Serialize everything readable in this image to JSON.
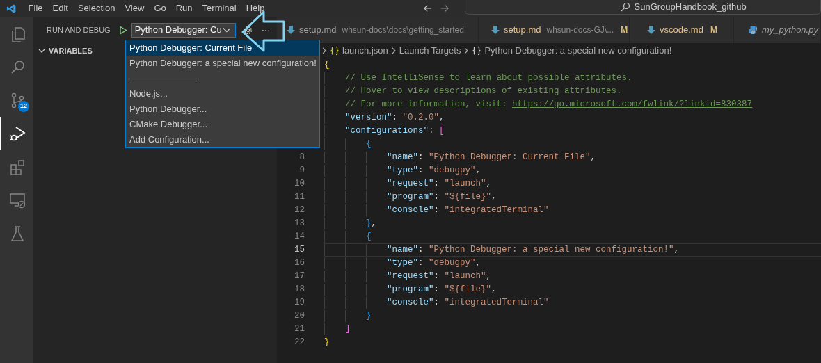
{
  "title_bar": {
    "menu": [
      "File",
      "Edit",
      "Selection",
      "View",
      "Go",
      "Run",
      "Terminal",
      "Help"
    ],
    "search": {
      "value": "SunGroupHandbook_github"
    }
  },
  "activity_bar": [
    {
      "kind": "explorer",
      "selected": false
    },
    {
      "kind": "search",
      "selected": false
    },
    {
      "kind": "source-control",
      "selected": false,
      "badge": "12"
    },
    {
      "kind": "run-debug",
      "selected": true
    },
    {
      "kind": "extensions",
      "selected": false
    },
    {
      "kind": "remote",
      "selected": false
    },
    {
      "kind": "testing",
      "selected": false
    }
  ],
  "sidebar": {
    "title": "RUN AND DEBUG",
    "config_select": {
      "value": "Python Debugger: Cu"
    },
    "more": "···",
    "sections": [
      {
        "label": "VARIABLES",
        "expanded": true
      }
    ]
  },
  "dropdown": {
    "options": [
      {
        "kind": "option",
        "label": "Python Debugger: Current File",
        "selected": true
      },
      {
        "kind": "option",
        "label": "Python Debugger: a special new configuration!",
        "selected": false
      },
      {
        "kind": "separator"
      },
      {
        "kind": "option",
        "label": "Node.js...",
        "selected": false
      },
      {
        "kind": "option",
        "label": "Python Debugger...",
        "selected": false
      },
      {
        "kind": "option",
        "label": "CMake Debugger...",
        "selected": false
      },
      {
        "kind": "option",
        "label": "Add Configuration...",
        "selected": false
      }
    ]
  },
  "tabs": [
    {
      "kind": "markdown",
      "name": "setup.md",
      "description": "whsun-docs\\docs\\getting_started",
      "preview": false
    },
    {
      "kind": "markdown",
      "name": "setup.md",
      "description": "whsun-docs-GJ\\...",
      "modified": "M",
      "preview": false
    },
    {
      "kind": "markdown",
      "name": "vscode.md",
      "modified": "M",
      "preview": false
    },
    {
      "kind": "python",
      "name": "my_python.py",
      "preview": true
    }
  ],
  "breadcrumbs": [
    {
      "kind": "file",
      "label": "launch.json"
    },
    {
      "kind": "text",
      "label": "Launch Targets"
    },
    {
      "kind": "object",
      "label": "Python Debugger: a special new configuration!"
    }
  ],
  "editor": {
    "lines": [
      {
        "current": false,
        "tokens": [
          {
            "kind": "brace1",
            "text": "{"
          }
        ]
      },
      {
        "current": false,
        "tokens": [
          {
            "kind": "comment",
            "text": "    // Use IntelliSense to learn about possible attributes."
          }
        ]
      },
      {
        "current": false,
        "tokens": [
          {
            "kind": "comment",
            "text": "    // Hover to view descriptions of existing attributes."
          }
        ]
      },
      {
        "current": false,
        "tokens": [
          {
            "kind": "comment",
            "text": "    // For more information, visit: "
          },
          {
            "kind": "link",
            "text": "https://go.microsoft.com/fwlink/?linkid=830387"
          }
        ]
      },
      {
        "current": false,
        "tokens": [
          {
            "kind": "key",
            "text": "    \"version\""
          },
          {
            "kind": "punct",
            "text": ": "
          },
          {
            "kind": "string",
            "text": "\"0.2.0\""
          },
          {
            "kind": "punct",
            "text": ","
          }
        ]
      },
      {
        "current": false,
        "tokens": [
          {
            "kind": "key",
            "text": "    \"configurations\""
          },
          {
            "kind": "punct",
            "text": ": "
          },
          {
            "kind": "brace2",
            "text": "["
          }
        ]
      },
      {
        "current": false,
        "tokens": [
          {
            "kind": "brace3",
            "text": "        {"
          }
        ]
      },
      {
        "number": "8",
        "current": false,
        "tokens": [
          {
            "kind": "key",
            "text": "            \"name\""
          },
          {
            "kind": "punct",
            "text": ": "
          },
          {
            "kind": "string",
            "text": "\"Python Debugger: Current File\""
          },
          {
            "kind": "punct",
            "text": ","
          }
        ]
      },
      {
        "number": "9",
        "current": false,
        "tokens": [
          {
            "kind": "key",
            "text": "            \"type\""
          },
          {
            "kind": "punct",
            "text": ": "
          },
          {
            "kind": "string",
            "text": "\"debugpy\""
          },
          {
            "kind": "punct",
            "text": ","
          }
        ]
      },
      {
        "number": "10",
        "current": false,
        "tokens": [
          {
            "kind": "key",
            "text": "            \"request\""
          },
          {
            "kind": "punct",
            "text": ": "
          },
          {
            "kind": "string",
            "text": "\"launch\""
          },
          {
            "kind": "punct",
            "text": ","
          }
        ]
      },
      {
        "number": "11",
        "current": false,
        "tokens": [
          {
            "kind": "key",
            "text": "            \"program\""
          },
          {
            "kind": "punct",
            "text": ": "
          },
          {
            "kind": "string",
            "text": "\"${file}\""
          },
          {
            "kind": "punct",
            "text": ","
          }
        ]
      },
      {
        "number": "12",
        "current": false,
        "tokens": [
          {
            "kind": "key",
            "text": "            \"console\""
          },
          {
            "kind": "punct",
            "text": ": "
          },
          {
            "kind": "string",
            "text": "\"integratedTerminal\""
          }
        ]
      },
      {
        "number": "13",
        "current": false,
        "tokens": [
          {
            "kind": "brace3",
            "text": "        }"
          },
          {
            "kind": "punct",
            "text": ","
          }
        ]
      },
      {
        "number": "14",
        "current": false,
        "tokens": [
          {
            "kind": "brace3",
            "text": "        {"
          }
        ]
      },
      {
        "number": "15",
        "current": true,
        "tokens": [
          {
            "kind": "key",
            "text": "            \"name\""
          },
          {
            "kind": "punct",
            "text": ": "
          },
          {
            "kind": "string",
            "text": "\"Python Debugger: a special new configuration!\""
          },
          {
            "kind": "punct",
            "text": ","
          }
        ]
      },
      {
        "number": "16",
        "current": false,
        "tokens": [
          {
            "kind": "key",
            "text": "            \"type\""
          },
          {
            "kind": "punct",
            "text": ": "
          },
          {
            "kind": "string",
            "text": "\"debugpy\""
          },
          {
            "kind": "punct",
            "text": ","
          }
        ]
      },
      {
        "number": "17",
        "current": false,
        "tokens": [
          {
            "kind": "key",
            "text": "            \"request\""
          },
          {
            "kind": "punct",
            "text": ": "
          },
          {
            "kind": "string",
            "text": "\"launch\""
          },
          {
            "kind": "punct",
            "text": ","
          }
        ]
      },
      {
        "number": "18",
        "current": false,
        "tokens": [
          {
            "kind": "key",
            "text": "            \"program\""
          },
          {
            "kind": "punct",
            "text": ": "
          },
          {
            "kind": "string",
            "text": "\"${file}\""
          },
          {
            "kind": "punct",
            "text": ","
          }
        ]
      },
      {
        "number": "19",
        "current": false,
        "tokens": [
          {
            "kind": "key",
            "text": "            \"console\""
          },
          {
            "kind": "punct",
            "text": ": "
          },
          {
            "kind": "string",
            "text": "\"integratedTerminal\""
          }
        ]
      },
      {
        "number": "20",
        "current": false,
        "tokens": [
          {
            "kind": "brace3",
            "text": "        }"
          }
        ]
      },
      {
        "number": "21",
        "current": false,
        "tokens": [
          {
            "kind": "brace2",
            "text": "    ]"
          }
        ]
      },
      {
        "number": "22",
        "current": false,
        "tokens": [
          {
            "kind": "brace1",
            "text": "}"
          }
        ]
      }
    ]
  }
}
